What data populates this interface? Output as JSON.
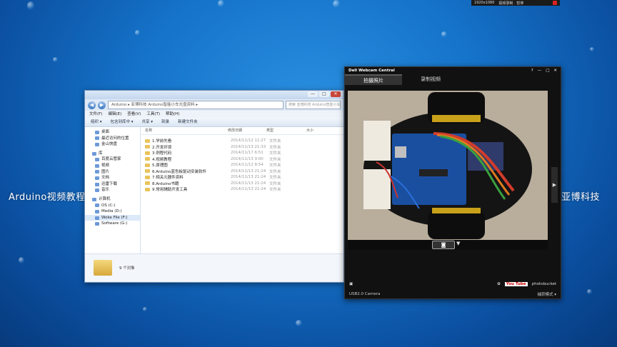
{
  "desktop": {
    "left_text": "Arduino视频教程",
    "right_text": "亚博科技",
    "recorder_bar": {
      "resolution": "1920x1080",
      "mode": "视频录制 · 暂停"
    }
  },
  "explorer": {
    "address": "Arduino ▸ 亚博科技 Arduino智能小车光盘资料 ▸",
    "search_placeholder": "搜索 亚博科技 Arduino智能小车光盘资...",
    "menu": [
      "文件(F)",
      "编辑(E)",
      "查看(V)",
      "工具(T)",
      "帮助(H)"
    ],
    "toolbar": [
      "组织 ▾",
      "包含到库中 ▾",
      "共享 ▾",
      "刻录",
      "新建文件夹"
    ],
    "nav": [
      {
        "label": "桌面",
        "group": false
      },
      {
        "label": "最近访问的位置",
        "group": false
      },
      {
        "label": "金山快盘",
        "group": false
      },
      {
        "label": "库",
        "group": true
      },
      {
        "label": "百度云管家",
        "group": false
      },
      {
        "label": "视频",
        "group": false
      },
      {
        "label": "图片",
        "group": false
      },
      {
        "label": "文档",
        "group": false
      },
      {
        "label": "迅雷下载",
        "group": false
      },
      {
        "label": "音乐",
        "group": false
      },
      {
        "label": "计算机",
        "group": true
      },
      {
        "label": "OS (C:)",
        "group": false
      },
      {
        "label": "Media (D:)",
        "group": false
      },
      {
        "label": "Woke File (F:)",
        "group": false
      },
      {
        "label": "Software (G:)",
        "group": false
      }
    ],
    "columns": [
      "名称",
      "修改日期",
      "类型",
      "大小"
    ],
    "files": [
      {
        "name": "1.学前先看",
        "date": "2014/11/12 11:27",
        "type": "文件夹"
      },
      {
        "name": "2.开发环境",
        "date": "2014/11/13 21:33",
        "type": "文件夹"
      },
      {
        "name": "3.例程代码",
        "date": "2014/11/17 6:51",
        "type": "文件夹"
      },
      {
        "name": "4.视频教程",
        "date": "2014/11/13 9:00",
        "type": "文件夹"
      },
      {
        "name": "5.原理图",
        "date": "2014/11/12 8:54",
        "type": "文件夹"
      },
      {
        "name": "6.Arduino蓝色板驱动安装软件",
        "date": "2014/11/13 21:24",
        "type": "文件夹"
      },
      {
        "name": "7.相关元器件资料",
        "date": "2014/11/13 21:24",
        "type": "文件夹"
      },
      {
        "name": "8.Arduino书籍",
        "date": "2014/11/13 21:24",
        "type": "文件夹"
      },
      {
        "name": "9.常用辅助开发工具",
        "date": "2014/11/13 21:24",
        "type": "文件夹"
      }
    ],
    "status": "9 个对象"
  },
  "webcam": {
    "title": "Dell Webcam Central",
    "controls": [
      "?",
      "—",
      "□",
      "✕"
    ],
    "tabs": [
      "拍摄照片",
      "录制视频"
    ],
    "capture_icon": "camera-icon",
    "bottom": {
      "youtube": "You Tube",
      "photobucket": "photobucket"
    },
    "status_left": "USB2.0 Camera",
    "status_right": "捕获模式 ▾"
  }
}
